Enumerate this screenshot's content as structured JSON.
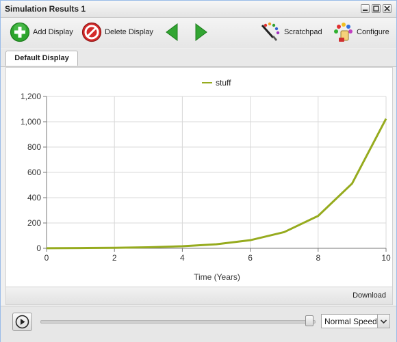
{
  "window": {
    "title": "Simulation Results 1"
  },
  "toolbar": {
    "add_display": "Add Display",
    "delete_display": "Delete Display",
    "scratchpad": "Scratchpad",
    "configure": "Configure"
  },
  "tabs": [
    {
      "label": "Default Display"
    }
  ],
  "footer": {
    "download": "Download"
  },
  "playback": {
    "speed": "Normal Speed",
    "position": 1.0
  },
  "colors": {
    "series": "#96ab1e",
    "accent_green": "#2a9d2a",
    "accent_red": "#cc2020"
  },
  "icons": {
    "add": "plus-circle-icon",
    "delete": "no-entry-icon",
    "back": "arrow-left-icon",
    "forward": "arrow-right-icon",
    "scratchpad": "paint-brush-icon",
    "configure": "palette-icon",
    "play": "play-icon"
  },
  "chart_data": {
    "type": "line",
    "xlabel": "Time (Years)",
    "ylabel": "",
    "xlim": [
      0,
      10
    ],
    "ylim": [
      0,
      1200
    ],
    "x_ticks": [
      "0",
      "2",
      "4",
      "6",
      "8",
      "10"
    ],
    "y_ticks": [
      "0",
      "200",
      "400",
      "600",
      "800",
      "1,000",
      "1,200"
    ],
    "x": [
      0,
      1,
      2,
      3,
      4,
      5,
      6,
      7,
      8,
      9,
      10
    ],
    "series": [
      {
        "name": "stuff",
        "color": "#96ab1e",
        "values": [
          1,
          2,
          4,
          8,
          16,
          32,
          64,
          128,
          256,
          512,
          1024
        ]
      }
    ],
    "grid": true,
    "legend": "top-center"
  }
}
